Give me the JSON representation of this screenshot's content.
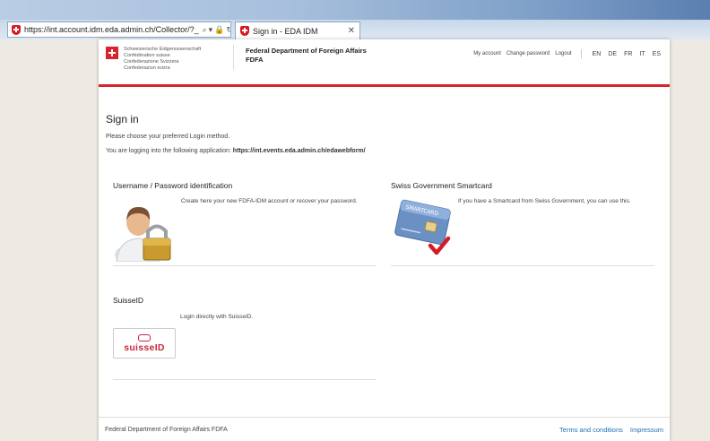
{
  "browser": {
    "address": "https://int.account.idm.eda.admin.ch/Collector/?_",
    "tab_title": "Sign in - EDA IDM"
  },
  "header": {
    "brand_lines": [
      "Schweizerische Eidgenossenschaft",
      "Confédération suisse",
      "Confederazione Svizzera",
      "Confederaziun svizra"
    ],
    "department": "Federal Department of Foreign Affairs",
    "department_abbr": "FDFA",
    "links": {
      "my_account": "My account",
      "change_password": "Change password",
      "logout": "Logout"
    },
    "languages": [
      "EN",
      "DE",
      "FR",
      "IT",
      "ES"
    ]
  },
  "main": {
    "title": "Sign in",
    "hint": "Please choose your preferred Login method.",
    "app_prefix": "You are logging into the following application:",
    "app_url": "https://int.events.eda.admin.ch/edawebform/"
  },
  "options": {
    "userpass": {
      "title": "Username / Password identification",
      "text": "Create here your new FDFA-IDM account or recover your password."
    },
    "smartcard": {
      "title": "Swiss Government Smartcard",
      "text": "If you have a Smartcard from Swiss Government, you can use this.",
      "card_label": "SMARTCARD"
    },
    "suisseid": {
      "title": "SuisseID",
      "text": "Login directly with SuisseID.",
      "logo_text": "suisseID"
    }
  },
  "footer": {
    "left": "Federal Department of Foreign Affairs FDFA",
    "terms": "Terms and conditions",
    "impressum": "Impressum"
  },
  "colors": {
    "swiss_red": "#d8232a",
    "link_blue": "#1f6fb2",
    "suisseid_red": "#c5283d"
  }
}
